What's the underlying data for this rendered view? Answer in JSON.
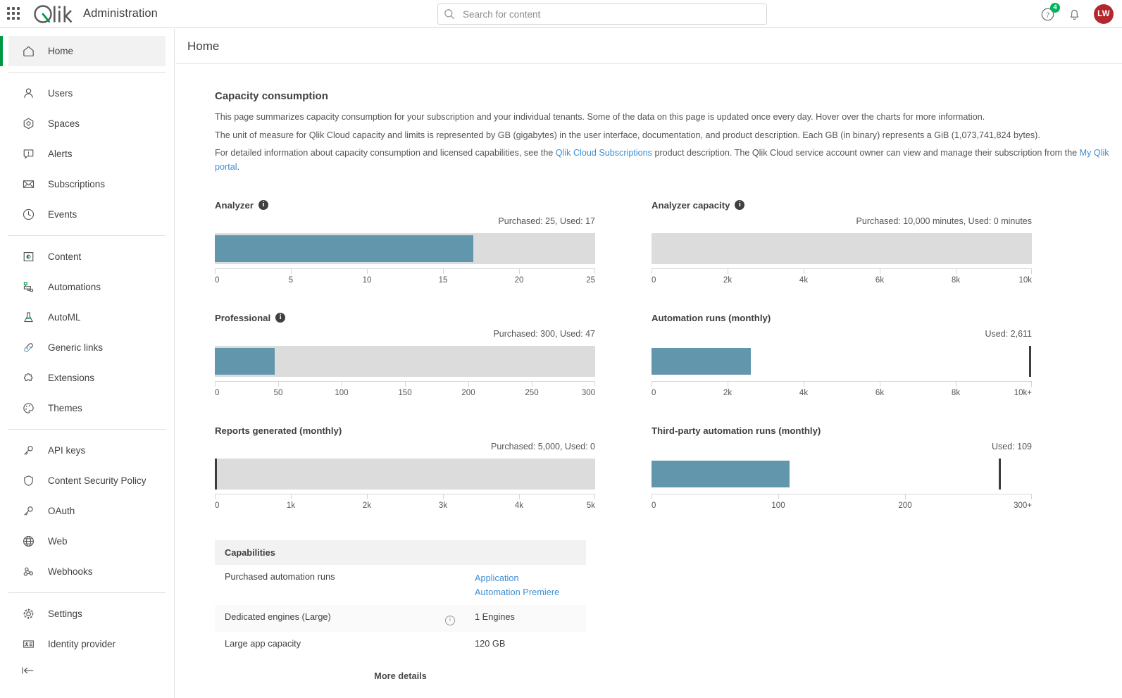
{
  "topbar": {
    "app_title": "Administration",
    "logo_text": "Qlik",
    "waffle_icon": "app-grid-icon",
    "search": {
      "placeholder": "Search for content",
      "value": "",
      "icon": "search-icon"
    },
    "help_icon": "help-circle-icon",
    "help_badge": "4",
    "notifications_icon": "bell-icon",
    "avatar_initials": "LW",
    "avatar_color": "#b4282d",
    "badge_color": "#00b65a"
  },
  "sidebar": {
    "collapse_icon": "collapse-left-icon",
    "groups": [
      {
        "items": [
          {
            "label": "Home",
            "icon": "home-icon",
            "active": true
          }
        ]
      },
      {
        "items": [
          {
            "label": "Users",
            "icon": "user-icon",
            "active": false
          },
          {
            "label": "Spaces",
            "icon": "spaces-icon",
            "active": false
          },
          {
            "label": "Alerts",
            "icon": "alert-icon",
            "active": false
          },
          {
            "label": "Subscriptions",
            "icon": "envelope-icon",
            "active": false
          },
          {
            "label": "Events",
            "icon": "clock-icon",
            "active": false
          }
        ]
      },
      {
        "items": [
          {
            "label": "Content",
            "icon": "content-icon",
            "active": false
          },
          {
            "label": "Automations",
            "icon": "automations-icon",
            "active": false
          },
          {
            "label": "AutoML",
            "icon": "flask-icon",
            "active": false
          },
          {
            "label": "Generic links",
            "icon": "link-icon",
            "active": false
          },
          {
            "label": "Extensions",
            "icon": "puzzle-icon",
            "active": false
          },
          {
            "label": "Themes",
            "icon": "palette-icon",
            "active": false
          }
        ]
      },
      {
        "items": [
          {
            "label": "API keys",
            "icon": "key-icon",
            "active": false
          },
          {
            "label": "Content Security Policy",
            "icon": "shield-icon",
            "active": false
          },
          {
            "label": "OAuth",
            "icon": "key-icon",
            "active": false
          },
          {
            "label": "Web",
            "icon": "globe-icon",
            "active": false
          },
          {
            "label": "Webhooks",
            "icon": "webhook-icon",
            "active": false
          }
        ]
      },
      {
        "items": [
          {
            "label": "Settings",
            "icon": "gear-icon",
            "active": false
          },
          {
            "label": "Identity provider",
            "icon": "id-card-icon",
            "active": false
          }
        ]
      }
    ]
  },
  "page": {
    "title": "Home",
    "section_title": "Capacity consumption",
    "paragraphs": [
      "This page summarizes capacity consumption for your subscription and your individual tenants. Some of the data on this page is updated once every day. Hover over the charts for more information.",
      "The unit of measure for Qlik Cloud capacity and limits is represented by GB (gigabytes) in the user interface, documentation, and product description. Each GB (in binary) represents a GiB (1,073,741,824 bytes)."
    ],
    "para3_pre": "For detailed information about capacity consumption and licensed capabilities, see the ",
    "para3_link1": "Qlik Cloud Subscriptions",
    "para3_mid": " product description. The Qlik Cloud service account owner can view and manage their subscription from the ",
    "para3_link2": "My Qlik portal",
    "para3_post": "."
  },
  "chart_data": [
    {
      "type": "bar",
      "title": "Analyzer",
      "has_info": true,
      "subtitle": "Purchased: 25, Used: 17",
      "purchased": 25,
      "used": 17,
      "value_pct": 68,
      "xlim": [
        0,
        25
      ],
      "ticks": [
        0,
        5,
        10,
        15,
        20,
        25
      ],
      "tick_labels": [
        "0",
        "5",
        "10",
        "15",
        "20",
        "25"
      ],
      "mode": "purchased",
      "bar_color": "#6296ac",
      "track_color": "#dcdcdc"
    },
    {
      "type": "bar",
      "title": "Analyzer capacity",
      "has_info": true,
      "subtitle": "Purchased: 10,000 minutes, Used: 0 minutes",
      "purchased": 10000,
      "used": 0,
      "value_pct": 0,
      "xlim": [
        0,
        10000
      ],
      "ticks": [
        0,
        2000,
        4000,
        6000,
        8000,
        10000
      ],
      "tick_labels": [
        "0",
        "2k",
        "4k",
        "6k",
        "8k",
        "10k"
      ],
      "mode": "purchased",
      "bar_color": "#6296ac",
      "track_color": "#dcdcdc"
    },
    {
      "type": "bar",
      "title": "Professional",
      "has_info": true,
      "subtitle": "Purchased: 300, Used: 47",
      "purchased": 300,
      "used": 47,
      "value_pct": 15.67,
      "xlim": [
        0,
        300
      ],
      "ticks": [
        0,
        50,
        100,
        150,
        200,
        250,
        300
      ],
      "tick_labels": [
        "0",
        "50",
        "100",
        "150",
        "200",
        "250",
        "300"
      ],
      "mode": "purchased",
      "bar_color": "#6296ac",
      "track_color": "#dcdcdc"
    },
    {
      "type": "bar",
      "title": "Automation runs (monthly)",
      "has_info": false,
      "subtitle": "Used: 2,611",
      "used": 2611,
      "value_pct": 26.11,
      "xlim": [
        0,
        10000
      ],
      "ticks": [
        0,
        2000,
        4000,
        6000,
        8000,
        10000
      ],
      "tick_labels": [
        "0",
        "2k",
        "4k",
        "6k",
        "8k",
        "10k+"
      ],
      "mode": "usage",
      "marker_pct": 99.4,
      "bar_color": "#6296ac",
      "marker_color": "#3d3d3d"
    },
    {
      "type": "bar",
      "title": "Reports generated (monthly)",
      "has_info": false,
      "subtitle": "Purchased: 5,000, Used: 0",
      "purchased": 5000,
      "used": 0,
      "value_pct": 0,
      "xlim": [
        0,
        5000
      ],
      "ticks": [
        0,
        1000,
        2000,
        3000,
        4000,
        5000
      ],
      "tick_labels": [
        "0",
        "1k",
        "2k",
        "3k",
        "4k",
        "5k"
      ],
      "mode": "purchased",
      "start_marker": true,
      "bar_color": "#6296ac",
      "track_color": "#dcdcdc"
    },
    {
      "type": "bar",
      "title": "Third-party automation runs (monthly)",
      "has_info": false,
      "subtitle": "Used: 109",
      "used": 109,
      "value_pct": 36.3,
      "xlim": [
        0,
        300
      ],
      "ticks": [
        0,
        100,
        200,
        300
      ],
      "tick_labels": [
        "0",
        "100",
        "200",
        "300+"
      ],
      "mode": "usage",
      "marker_pct": 91.5,
      "bar_color": "#6296ac",
      "marker_color": "#3d3d3d"
    }
  ],
  "capabilities": {
    "header": "Capabilities",
    "rows": [
      {
        "name": "Purchased automation runs",
        "info": false,
        "value": "",
        "links": [
          "Application",
          "Automation Premiere"
        ]
      },
      {
        "name": "Dedicated engines (Large)",
        "info": true,
        "value": "1 Engines",
        "links": []
      },
      {
        "name": "Large app capacity",
        "info": false,
        "value": "120 GB",
        "links": []
      }
    ],
    "more_details": "More details"
  }
}
